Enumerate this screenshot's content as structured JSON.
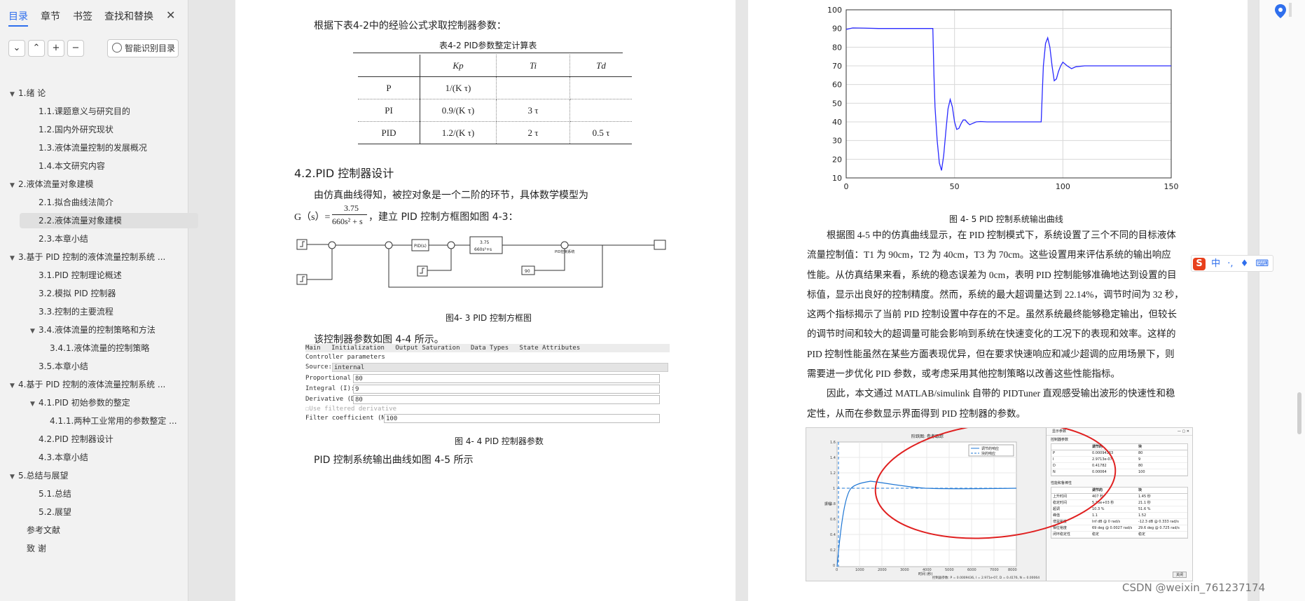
{
  "sidebar": {
    "tabs": [
      "目录",
      "章节",
      "书签",
      "查找和替换"
    ],
    "close_icon": "close-icon",
    "buttons": {
      "collapse": "⌄",
      "expand": "⌃",
      "add": "+",
      "remove": "−"
    },
    "smart_label": "智能识别目录",
    "toc": [
      {
        "label": "1.绪  论",
        "level": 1,
        "arrow": "▼"
      },
      {
        "label": "1.1.课题意义与研究目的",
        "level": 2
      },
      {
        "label": "1.2.国内外研究现状",
        "level": 2
      },
      {
        "label": "1.3.液体流量控制的发展概况",
        "level": 2
      },
      {
        "label": "1.4.本文研究内容",
        "level": 2
      },
      {
        "label": "2.液体流量对象建模",
        "level": 1,
        "arrow": "▼"
      },
      {
        "label": "2.1.拟合曲线法简介",
        "level": 2
      },
      {
        "label": "2.2.液体流量对象建模",
        "level": 2,
        "selected": true
      },
      {
        "label": "2.3.本章小结",
        "level": 2
      },
      {
        "label": "3.基于 PID 控制的液体流量控制系统 ...",
        "level": 1,
        "arrow": "▼"
      },
      {
        "label": "3.1.PID 控制理论概述",
        "level": 2
      },
      {
        "label": "3.2.模拟 PID 控制器",
        "level": 2
      },
      {
        "label": "3.3.控制的主要流程",
        "level": 2
      },
      {
        "label": "3.4.液体流量的控制策略和方法",
        "level": 2,
        "arrow": "▼"
      },
      {
        "label": "3.4.1.液体流量的控制策略",
        "level": 3
      },
      {
        "label": "3.5.本章小结",
        "level": 2
      },
      {
        "label": "4.基于 PID 控制的液体流量控制系统 ...",
        "level": 1,
        "arrow": "▼"
      },
      {
        "label": "4.1.PID 初始参数的整定",
        "level": 2,
        "arrow": "▼"
      },
      {
        "label": "4.1.1.两种工业常用的参数整定 ...",
        "level": 3
      },
      {
        "label": "4.2.PID 控制器设计",
        "level": 2
      },
      {
        "label": "4.3.本章小结",
        "level": 2
      },
      {
        "label": "5.总结与展望",
        "level": 1,
        "arrow": "▼"
      },
      {
        "label": "5.1.总结",
        "level": 2
      },
      {
        "label": "5.2.展望",
        "level": 2
      },
      {
        "label": "参考文献",
        "level": 0
      },
      {
        "label": "致  谢",
        "level": 0
      }
    ]
  },
  "page1": {
    "intro": "根据下表4-2中的经验公式求取控制器参数：",
    "table_caption": "表4-2  PID参数整定计算表",
    "table_head": [
      "",
      "Kp",
      "Ti",
      "Td"
    ],
    "table_rows": [
      [
        "P",
        "1/(K τ)",
        "",
        ""
      ],
      [
        "PI",
        "0.9/(K τ)",
        "3 τ",
        ""
      ],
      [
        "PID",
        "1.2/(K τ)",
        "2 τ",
        "0.5 τ"
      ]
    ],
    "section_title": "4.2.PID 控制器设计",
    "para1": "由仿真曲线得知，被控对象是一个二阶的环节，具体数学模型为",
    "formula_lhs": "G（s）=",
    "formula_num": "3.75",
    "formula_den": "660s² + s",
    "formula_tail": "，建立 PID 控制方框图如图 4-3：",
    "block_labels": {
      "pid": "PID(s)",
      "tf_num": "3.75",
      "tf_den": "660s²+s",
      "const": "90",
      "scope_label": "PID控制系统"
    },
    "fig3_caption": "图4- 3 PID 控制方框图",
    "para2": "该控制器参数如图 4-4 所示。",
    "param_tabs": [
      "Main",
      "Initialization",
      "Output Saturation",
      "Data Types",
      "State Attributes"
    ],
    "param_title": "Controller parameters",
    "source_label": "Source:",
    "source_value": "internal",
    "params": [
      {
        "label": "Proportional (P):",
        "value": "80"
      },
      {
        "label": "Integral (I):",
        "value": "9"
      },
      {
        "label": "Derivative (D):",
        "value": "80"
      }
    ],
    "use_filtered": "Use filtered derivative",
    "filter_label": "Filter coefficient (N):",
    "filter_value": "100",
    "fig4_caption": "图 4- 4 PID 控制器参数",
    "para3": "PID 控制系统输出曲线如图 4-5 所示"
  },
  "page2": {
    "fig5_caption": "图 4- 5 PID 控制系统输出曲线",
    "paragraph_lines": [
      "根据图 4-5 中的仿真曲线显示，在 PID 控制模式下，系统设置了三个不同的目标液体",
      "流量控制值：T1 为 90cm，T2 为 40cm，T3 为 70cm。这些设置用来评估系统的输出响应",
      "性能。从仿真结果来看，系统的稳态误差为 0cm，表明 PID 控制能够准确地达到设置的目",
      "标值，显示出良好的控制精度。然而，系统的最大超调量达到 22.14%，调节时间为 32 秒，",
      "这两个指标揭示了当前 PID 控制设置中存在的不足。虽然系统最终能够稳定输出，但较长",
      "的调节时间和较大的超调量可能会影响到系统在快速变化的工况下的表现和效率。这样的",
      "PID 控制性能虽然在某些方面表现优异，但在要求快速响应和减少超调的应用场景下，则",
      "需要进一步优化 PID 参数，或考虑采用其他控制策略以改善这些性能指标。",
      "因此，本文通过 MATLAB/simulink 自带的 PIDTuner 直观感受输出波形的快速性和稳",
      "定性，从而在参数显示界面得到 PID 控制器的参数。"
    ],
    "tuner": {
      "plot_title": "阶跃图: 参考跟踪",
      "legend": [
        "调节的响应",
        "块的响应"
      ],
      "xlabel": "时间 (秒)",
      "ylabel": "振幅",
      "yticks": [
        "1.6",
        "1.4",
        "1.2",
        "1",
        "0.8",
        "0.6",
        "0.4",
        "0.2",
        "0"
      ],
      "xticks": [
        "0",
        "1000",
        "2000",
        "3000",
        "4000",
        "5000",
        "6000",
        "7000",
        "8000"
      ],
      "status": "控制器参数: P = 0.0009436, I = 2.971e-07, D = 0.4176, N = 0.00064",
      "dialog_title": "显示参数",
      "section1": "控制器参数",
      "cols1": [
        "",
        "调节的",
        "块"
      ],
      "rows1": [
        [
          "P",
          "0.00094363",
          "80"
        ],
        [
          "I",
          "2.9713e-07",
          "9"
        ],
        [
          "D",
          "0.41782",
          "80"
        ],
        [
          "N",
          "0.00064",
          "100"
        ]
      ],
      "section2": "性能和鲁棒性",
      "cols2": [
        "",
        "调节的",
        "块"
      ],
      "rows2": [
        [
          "上升时间",
          "407 秒",
          "1.45 秒"
        ],
        [
          "稳定时间",
          "5.35e+03 秒",
          "21.1 秒"
        ],
        [
          "超调",
          "10.3 %",
          "51.6 %"
        ],
        [
          "峰值",
          "1.1",
          "1.52"
        ],
        [
          "增益裕度",
          "Inf dB @ 0 rad/s",
          "-12.3 dB @ 0.333 rad/s"
        ],
        [
          "相位裕度",
          "69 deg @ 0.0027 rad/s",
          "29.6 deg @ 0.725 rad/s"
        ],
        [
          "闭环稳定性",
          "稳定",
          "稳定"
        ]
      ],
      "close_btn": "关闭"
    }
  },
  "chart_data": {
    "type": "line",
    "title": "",
    "xlabel": "",
    "ylabel": "",
    "xlim": [
      0,
      150
    ],
    "ylim": [
      10,
      100
    ],
    "xticks": [
      0,
      50,
      100,
      150
    ],
    "yticks": [
      10,
      20,
      30,
      40,
      50,
      60,
      70,
      80,
      90,
      100
    ],
    "grid": true,
    "series": [
      {
        "color": "#2a2aff",
        "x": [
          0,
          3,
          8,
          15,
          25,
          35,
          40,
          40.5,
          41,
          42,
          43,
          44,
          45,
          46,
          47,
          48,
          49,
          50,
          51,
          52,
          53,
          54,
          55,
          56,
          57,
          58,
          60,
          62,
          65,
          70,
          80,
          90,
          90.5,
          91,
          92,
          93,
          94,
          95,
          96,
          97,
          98,
          99,
          100,
          102,
          104,
          106,
          110,
          120,
          130,
          150
        ],
        "y": [
          89.5,
          90.3,
          90.2,
          90,
          90,
          90,
          90,
          65,
          48,
          30,
          18,
          14,
          22,
          35,
          47,
          52,
          48,
          40,
          36,
          36.5,
          39,
          41,
          41,
          39.5,
          38.5,
          39,
          40,
          40.2,
          40,
          40,
          40,
          40,
          55,
          70,
          82,
          85,
          80,
          70,
          62,
          63,
          67,
          70,
          72,
          70,
          68.5,
          69.5,
          70,
          70,
          70,
          70
        ]
      }
    ]
  },
  "right": {
    "ime_items": [
      "中",
      "·,",
      "♦",
      "⌨"
    ],
    "watermark": "CSDN @weixin_761237174"
  }
}
